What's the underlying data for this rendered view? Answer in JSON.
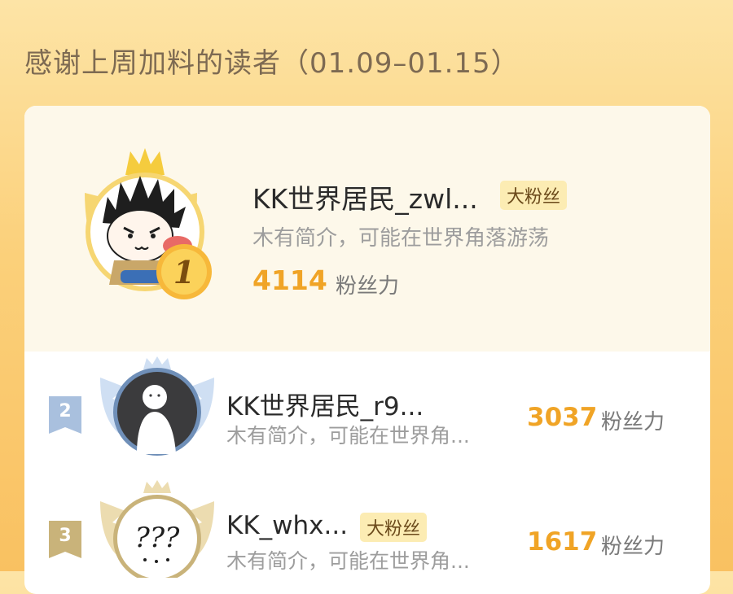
{
  "header": {
    "title": "感谢上周加料的读者（01.09–01.15）"
  },
  "colors": {
    "accent": "#f0a426",
    "badge_bg": "#fcecb3",
    "bio": "#9d9d9d"
  },
  "readers": [
    {
      "rank": "1",
      "name": "KK世界居民_zwl...",
      "badge": "大粉丝",
      "bio": "木有简介，可能在世界角落游荡",
      "score": "4114",
      "score_unit": "粉丝力",
      "avatar_icon": "cartoon-saiyan-avatar"
    },
    {
      "rank": "2",
      "name": "KK世界居民_r9...",
      "bio": "木有简介，可能在世界角...",
      "score": "3037",
      "score_unit": "粉丝力",
      "avatar_icon": "white-doodle-person-avatar"
    },
    {
      "rank": "3",
      "name": "KK_whx...",
      "badge": "大粉丝",
      "bio": "木有简介，可能在世界角...",
      "score": "1617",
      "score_unit": "粉丝力",
      "avatar_icon": "question-marks-avatar",
      "avatar_text": "???"
    }
  ]
}
